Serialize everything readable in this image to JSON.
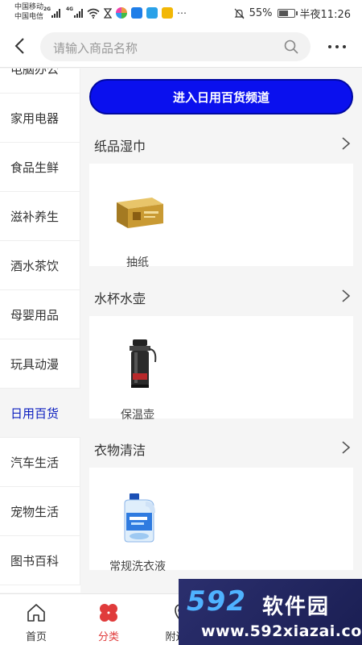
{
  "status_bar": {
    "carrier_1": "中国移动",
    "carrier_2": "中国电信",
    "signal_1_tag": "2G",
    "signal_2_tag": "4G",
    "battery": "55%",
    "time": "半夜11:26"
  },
  "header": {
    "search_placeholder": "请输入商品名称"
  },
  "sidebar": {
    "items": [
      {
        "label": "电脑办公"
      },
      {
        "label": "家用电器"
      },
      {
        "label": "食品生鲜"
      },
      {
        "label": "滋补养生"
      },
      {
        "label": "酒水茶饮"
      },
      {
        "label": "母婴用品"
      },
      {
        "label": "玩具动漫"
      },
      {
        "label": "日用百货"
      },
      {
        "label": "汽车生活"
      },
      {
        "label": "宠物生活"
      },
      {
        "label": "图书百科"
      }
    ],
    "active_index": 7
  },
  "main": {
    "channel_button": "进入日用百货频道",
    "sections": [
      {
        "title": "纸品湿巾",
        "product": "抽纸"
      },
      {
        "title": "水杯水壶",
        "product": "保温壶"
      },
      {
        "title": "衣物清洁",
        "product": "常规洗衣液"
      }
    ]
  },
  "bottom_nav": {
    "items": [
      {
        "label": "首页"
      },
      {
        "label": "分类"
      },
      {
        "label": "附近商"
      }
    ]
  },
  "watermark": {
    "number": "592",
    "name": "软件园",
    "url": "www.592xiazai.com"
  },
  "colors": {
    "accent": "#0a10ee",
    "active_sidebar": "#0a1dbf",
    "nav_active": "#e03b3b"
  }
}
